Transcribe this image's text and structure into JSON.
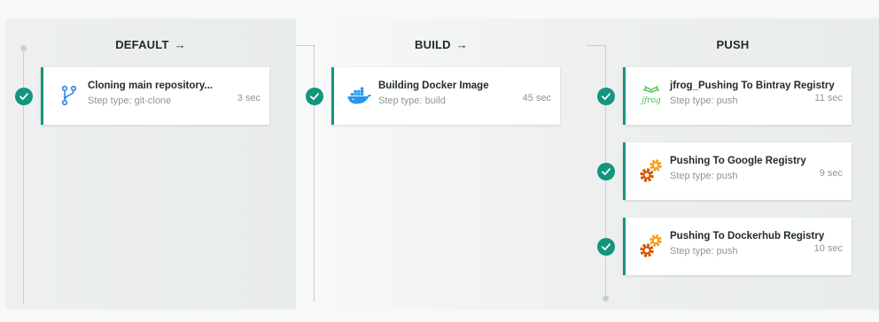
{
  "stages": [
    {
      "title": "DEFAULT",
      "has_arrow": true,
      "steps": [
        {
          "name": "Cloning main repository...",
          "type": "Step type: git-clone",
          "duration": "3 sec",
          "icon": "git-branch-icon"
        }
      ]
    },
    {
      "title": "BUILD",
      "has_arrow": true,
      "steps": [
        {
          "name": "Building Docker Image",
          "type": "Step type: build",
          "duration": "45 sec",
          "icon": "docker-icon"
        }
      ]
    },
    {
      "title": "PUSH",
      "has_arrow": false,
      "steps": [
        {
          "name": "jfrog_Pushing To Bintray Registry",
          "type": "Step type: push",
          "duration": "11 sec",
          "icon": "jfrog-icon",
          "icon_text": "jfrog"
        },
        {
          "name": "Pushing To Google Registry",
          "type": "Step type: push",
          "duration": "9 sec",
          "icon": "gears-icon"
        },
        {
          "name": "Pushing To Dockerhub Registry",
          "type": "Step type: push",
          "duration": "10 sec",
          "icon": "gears-icon"
        }
      ]
    }
  ],
  "arrow_glyph": "→",
  "colors": {
    "success": "#13967e",
    "connector": "#c9cfcf",
    "gear_orange": "#f39c12",
    "gear_red": "#d35400",
    "docker_blue": "#2496ed",
    "jfrog_green": "#41bf47"
  }
}
